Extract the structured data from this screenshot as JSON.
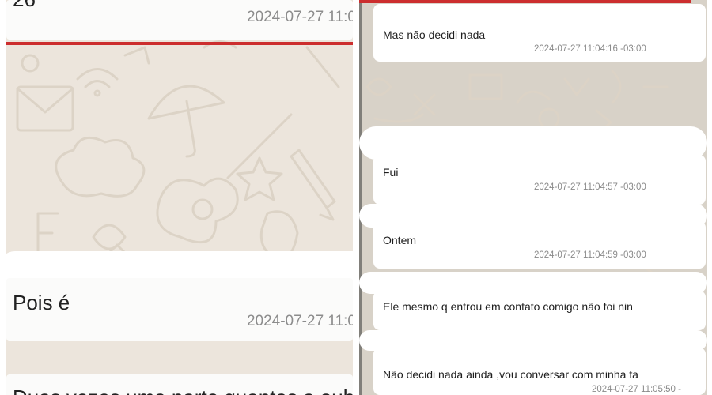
{
  "left_panel": {
    "partial_top_text": "26",
    "top_timestamp": "2024-07-27 11:0",
    "messages": [
      {
        "text": "Pois é",
        "timestamp": "2024-07-27 11:0"
      },
      {
        "text": "Duas vezes uma parte quantas a oub",
        "timestamp": ""
      }
    ]
  },
  "right_panel": {
    "messages": [
      {
        "text": "Mas não decidi nada",
        "timestamp": "2024-07-27 11:04:16 -03:00"
      },
      {
        "text": "Fui",
        "timestamp": "2024-07-27 11:04:57 -03:00"
      },
      {
        "text": "Ontem",
        "timestamp": "2024-07-27 11:04:59 -03:00"
      },
      {
        "text": "Ele mesmo q entrou em contato comigo não foi nin",
        "timestamp": ""
      },
      {
        "text": "Não decidi nada ainda ,vou conversar com minha fa",
        "timestamp": "2024-07-27 11:05:50 -"
      }
    ]
  },
  "colors": {
    "chat_background": "#ece5dc",
    "bubble": "#ffffff",
    "separator_line": "#cc2e2e",
    "timestamp": "#8c8c8c"
  }
}
